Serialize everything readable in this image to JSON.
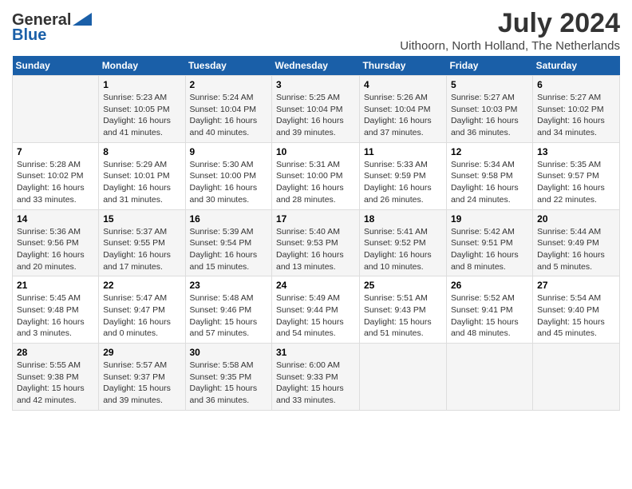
{
  "header": {
    "logo_general": "General",
    "logo_blue": "Blue",
    "month_year": "July 2024",
    "location": "Uithoorn, North Holland, The Netherlands"
  },
  "calendar": {
    "days_of_week": [
      "Sunday",
      "Monday",
      "Tuesday",
      "Wednesday",
      "Thursday",
      "Friday",
      "Saturday"
    ],
    "weeks": [
      [
        {
          "day": "",
          "info": ""
        },
        {
          "day": "1",
          "info": "Sunrise: 5:23 AM\nSunset: 10:05 PM\nDaylight: 16 hours\nand 41 minutes."
        },
        {
          "day": "2",
          "info": "Sunrise: 5:24 AM\nSunset: 10:04 PM\nDaylight: 16 hours\nand 40 minutes."
        },
        {
          "day": "3",
          "info": "Sunrise: 5:25 AM\nSunset: 10:04 PM\nDaylight: 16 hours\nand 39 minutes."
        },
        {
          "day": "4",
          "info": "Sunrise: 5:26 AM\nSunset: 10:04 PM\nDaylight: 16 hours\nand 37 minutes."
        },
        {
          "day": "5",
          "info": "Sunrise: 5:27 AM\nSunset: 10:03 PM\nDaylight: 16 hours\nand 36 minutes."
        },
        {
          "day": "6",
          "info": "Sunrise: 5:27 AM\nSunset: 10:02 PM\nDaylight: 16 hours\nand 34 minutes."
        }
      ],
      [
        {
          "day": "7",
          "info": "Sunrise: 5:28 AM\nSunset: 10:02 PM\nDaylight: 16 hours\nand 33 minutes."
        },
        {
          "day": "8",
          "info": "Sunrise: 5:29 AM\nSunset: 10:01 PM\nDaylight: 16 hours\nand 31 minutes."
        },
        {
          "day": "9",
          "info": "Sunrise: 5:30 AM\nSunset: 10:00 PM\nDaylight: 16 hours\nand 30 minutes."
        },
        {
          "day": "10",
          "info": "Sunrise: 5:31 AM\nSunset: 10:00 PM\nDaylight: 16 hours\nand 28 minutes."
        },
        {
          "day": "11",
          "info": "Sunrise: 5:33 AM\nSunset: 9:59 PM\nDaylight: 16 hours\nand 26 minutes."
        },
        {
          "day": "12",
          "info": "Sunrise: 5:34 AM\nSunset: 9:58 PM\nDaylight: 16 hours\nand 24 minutes."
        },
        {
          "day": "13",
          "info": "Sunrise: 5:35 AM\nSunset: 9:57 PM\nDaylight: 16 hours\nand 22 minutes."
        }
      ],
      [
        {
          "day": "14",
          "info": "Sunrise: 5:36 AM\nSunset: 9:56 PM\nDaylight: 16 hours\nand 20 minutes."
        },
        {
          "day": "15",
          "info": "Sunrise: 5:37 AM\nSunset: 9:55 PM\nDaylight: 16 hours\nand 17 minutes."
        },
        {
          "day": "16",
          "info": "Sunrise: 5:39 AM\nSunset: 9:54 PM\nDaylight: 16 hours\nand 15 minutes."
        },
        {
          "day": "17",
          "info": "Sunrise: 5:40 AM\nSunset: 9:53 PM\nDaylight: 16 hours\nand 13 minutes."
        },
        {
          "day": "18",
          "info": "Sunrise: 5:41 AM\nSunset: 9:52 PM\nDaylight: 16 hours\nand 10 minutes."
        },
        {
          "day": "19",
          "info": "Sunrise: 5:42 AM\nSunset: 9:51 PM\nDaylight: 16 hours\nand 8 minutes."
        },
        {
          "day": "20",
          "info": "Sunrise: 5:44 AM\nSunset: 9:49 PM\nDaylight: 16 hours\nand 5 minutes."
        }
      ],
      [
        {
          "day": "21",
          "info": "Sunrise: 5:45 AM\nSunset: 9:48 PM\nDaylight: 16 hours\nand 3 minutes."
        },
        {
          "day": "22",
          "info": "Sunrise: 5:47 AM\nSunset: 9:47 PM\nDaylight: 16 hours\nand 0 minutes."
        },
        {
          "day": "23",
          "info": "Sunrise: 5:48 AM\nSunset: 9:46 PM\nDaylight: 15 hours\nand 57 minutes."
        },
        {
          "day": "24",
          "info": "Sunrise: 5:49 AM\nSunset: 9:44 PM\nDaylight: 15 hours\nand 54 minutes."
        },
        {
          "day": "25",
          "info": "Sunrise: 5:51 AM\nSunset: 9:43 PM\nDaylight: 15 hours\nand 51 minutes."
        },
        {
          "day": "26",
          "info": "Sunrise: 5:52 AM\nSunset: 9:41 PM\nDaylight: 15 hours\nand 48 minutes."
        },
        {
          "day": "27",
          "info": "Sunrise: 5:54 AM\nSunset: 9:40 PM\nDaylight: 15 hours\nand 45 minutes."
        }
      ],
      [
        {
          "day": "28",
          "info": "Sunrise: 5:55 AM\nSunset: 9:38 PM\nDaylight: 15 hours\nand 42 minutes."
        },
        {
          "day": "29",
          "info": "Sunrise: 5:57 AM\nSunset: 9:37 PM\nDaylight: 15 hours\nand 39 minutes."
        },
        {
          "day": "30",
          "info": "Sunrise: 5:58 AM\nSunset: 9:35 PM\nDaylight: 15 hours\nand 36 minutes."
        },
        {
          "day": "31",
          "info": "Sunrise: 6:00 AM\nSunset: 9:33 PM\nDaylight: 15 hours\nand 33 minutes."
        },
        {
          "day": "",
          "info": ""
        },
        {
          "day": "",
          "info": ""
        },
        {
          "day": "",
          "info": ""
        }
      ]
    ]
  }
}
